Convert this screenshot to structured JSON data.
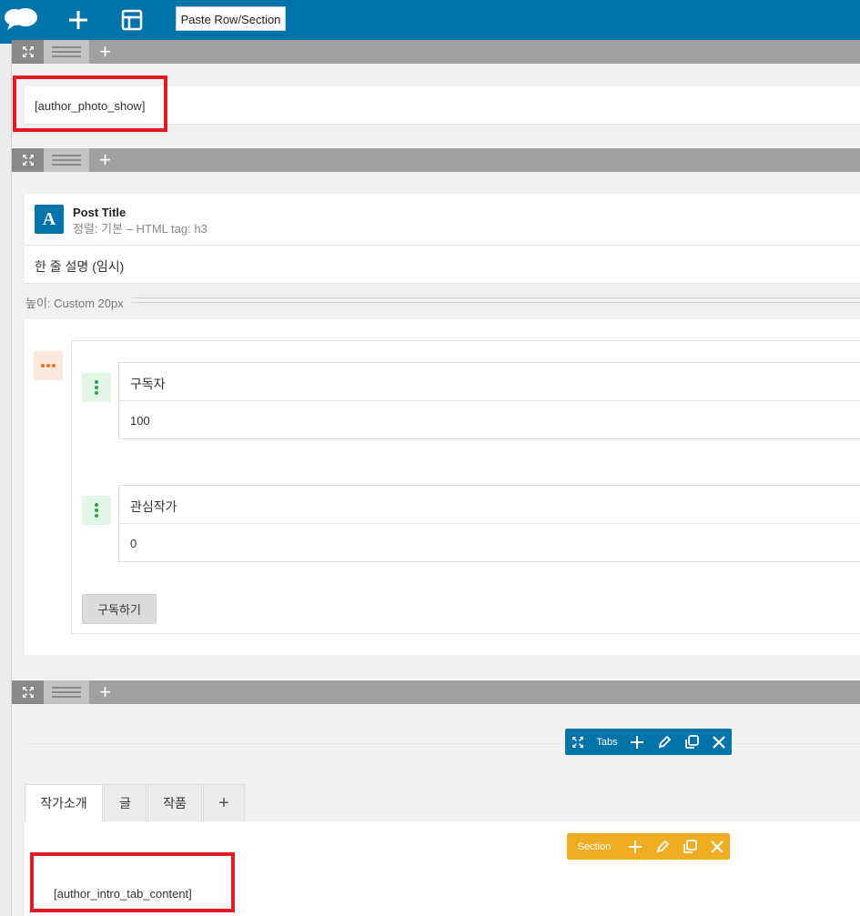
{
  "toolbar": {
    "logo_icon": "cloud-logo-icon",
    "add_icon": "plus-icon",
    "layout_icon": "layout-icon",
    "paste_label": "Paste Row/Section"
  },
  "rows": {
    "row1": {
      "shortcode": "[author_photo_show]"
    },
    "row2": {
      "title_element": {
        "title": "Post Title",
        "meta": "정렬: 기본  – HTML tag: h3"
      },
      "description": "한 줄 설명 (임시)",
      "spacer_label": "높이: Custom  20px",
      "counters": [
        {
          "label": "구독자",
          "value": "100"
        },
        {
          "label": "관심작가",
          "value": "0"
        }
      ],
      "subscribe_label": "구독하기"
    },
    "row3": {
      "tabs_toolbar_label": "Tabs",
      "tabs": [
        "작가소개",
        "글",
        "작품"
      ],
      "add_tab": "+",
      "section_toolbar_label": "Section",
      "shortcode": "[author_intro_tab_content]"
    }
  },
  "colors": {
    "topbar": "#0073aa",
    "highlight": "#e21b23",
    "tabs_toolbar": "#0073aa",
    "section_toolbar": "#f0ad22"
  }
}
